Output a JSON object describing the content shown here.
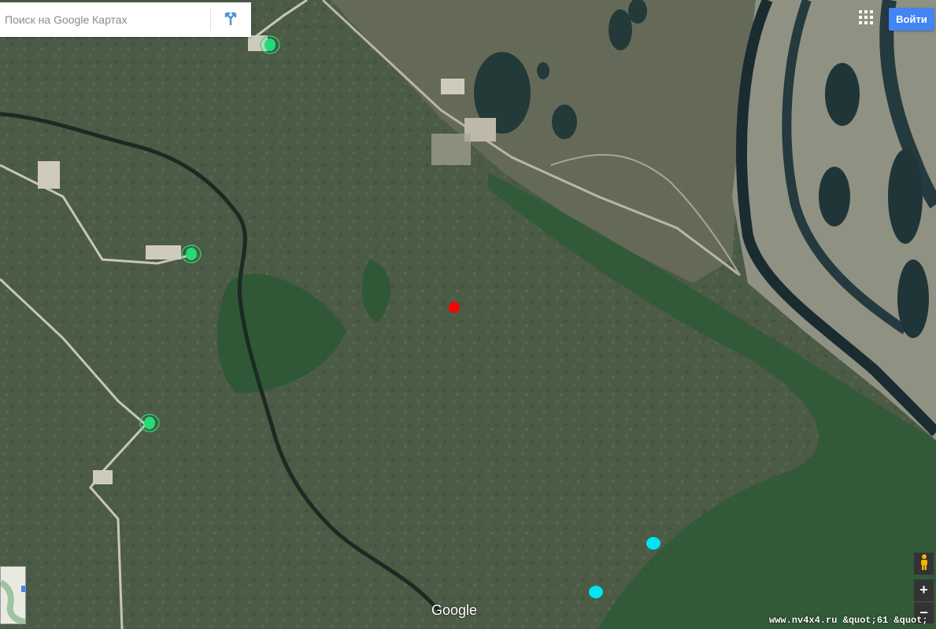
{
  "search": {
    "placeholder": "Поиск на Google Картах"
  },
  "header": {
    "signin_label": "Войти"
  },
  "controls": {
    "zoom_in": "+",
    "zoom_out": "−"
  },
  "branding": {
    "logo": "Google"
  },
  "watermark": {
    "text": "www.nv4x4.ru &quot;61 &quot;"
  },
  "map": {
    "type": "satellite",
    "markers": [
      {
        "label": "green",
        "color": "#22dd77",
        "ring": true
      },
      {
        "label": "green",
        "color": "#22dd77",
        "ring": true
      },
      {
        "label": "green",
        "color": "#22dd77",
        "ring": true
      },
      {
        "label": "red",
        "color": "#ff0000",
        "ring": false
      },
      {
        "label": "cyan",
        "color": "#00e5f5",
        "ring": false
      },
      {
        "label": "cyan",
        "color": "#00e5f5",
        "ring": false
      }
    ]
  },
  "colors": {
    "accent": "#4285f4",
    "terrain": "#4a5a45",
    "forest": "#2f5a35",
    "river": "#1a2a2e",
    "riverbank": "#9a9a8c"
  },
  "icons": [
    "directions-icon",
    "apps-grid-icon",
    "pegman-icon"
  ]
}
